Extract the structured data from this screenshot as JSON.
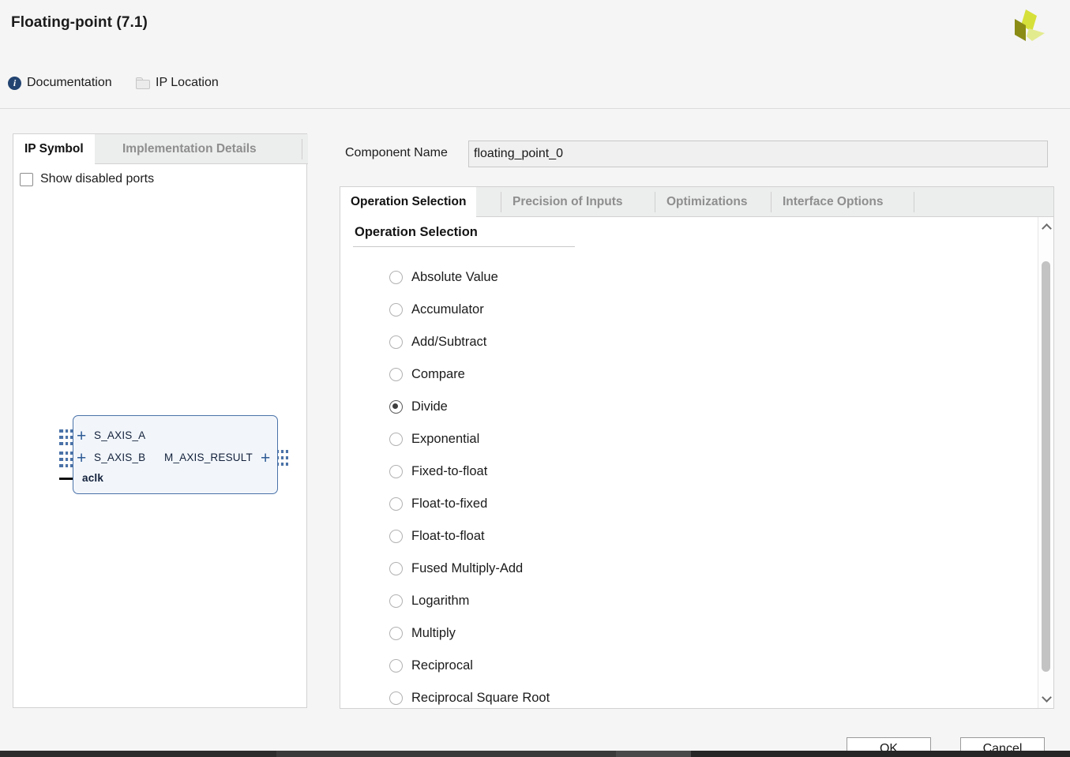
{
  "dialog": {
    "title": "Floating-point (7.1)",
    "logo_icon": "amd-xilinx-logo-icon"
  },
  "toolbar": {
    "documentation_label": "Documentation",
    "documentation_icon": "info-icon",
    "ip_location_label": "IP Location",
    "ip_location_icon": "folder-icon"
  },
  "left_panel": {
    "tabs": [
      {
        "label": "IP Symbol",
        "active": true
      },
      {
        "label": "Implementation Details",
        "active": false
      }
    ],
    "show_disabled_ports": {
      "label": "Show disabled ports",
      "checked": false
    },
    "ip_symbol": {
      "input_ports": [
        "S_AXIS_A",
        "S_AXIS_B"
      ],
      "output_ports": [
        "M_AXIS_RESULT"
      ],
      "clock_port": "aclk",
      "expand_marker": "+",
      "block_fill": "#f2f6fb",
      "block_stroke": "#4a72a8"
    }
  },
  "component_name": {
    "label": "Component Name",
    "value": "floating_point_0"
  },
  "right_panel": {
    "tabs": [
      {
        "label": "Operation Selection",
        "active": true
      },
      {
        "label": "Precision of Inputs",
        "active": false
      },
      {
        "label": "Optimizations",
        "active": false
      },
      {
        "label": "Interface Options",
        "active": false
      }
    ],
    "section_title": "Operation Selection",
    "operations": [
      {
        "label": "Absolute Value",
        "selected": false
      },
      {
        "label": "Accumulator",
        "selected": false
      },
      {
        "label": "Add/Subtract",
        "selected": false
      },
      {
        "label": "Compare",
        "selected": false
      },
      {
        "label": "Divide",
        "selected": true
      },
      {
        "label": "Exponential",
        "selected": false
      },
      {
        "label": "Fixed-to-float",
        "selected": false
      },
      {
        "label": "Float-to-fixed",
        "selected": false
      },
      {
        "label": "Float-to-float",
        "selected": false
      },
      {
        "label": "Fused Multiply-Add",
        "selected": false
      },
      {
        "label": "Logarithm",
        "selected": false
      },
      {
        "label": "Multiply",
        "selected": false
      },
      {
        "label": "Reciprocal",
        "selected": false
      },
      {
        "label": "Reciprocal Square Root",
        "selected": false
      }
    ],
    "scrollbar": {
      "up_icon": "chevron-up-icon",
      "down_icon": "chevron-down-icon"
    }
  },
  "footer": {
    "ok_label": "OK",
    "cancel_label": "Cancel"
  }
}
